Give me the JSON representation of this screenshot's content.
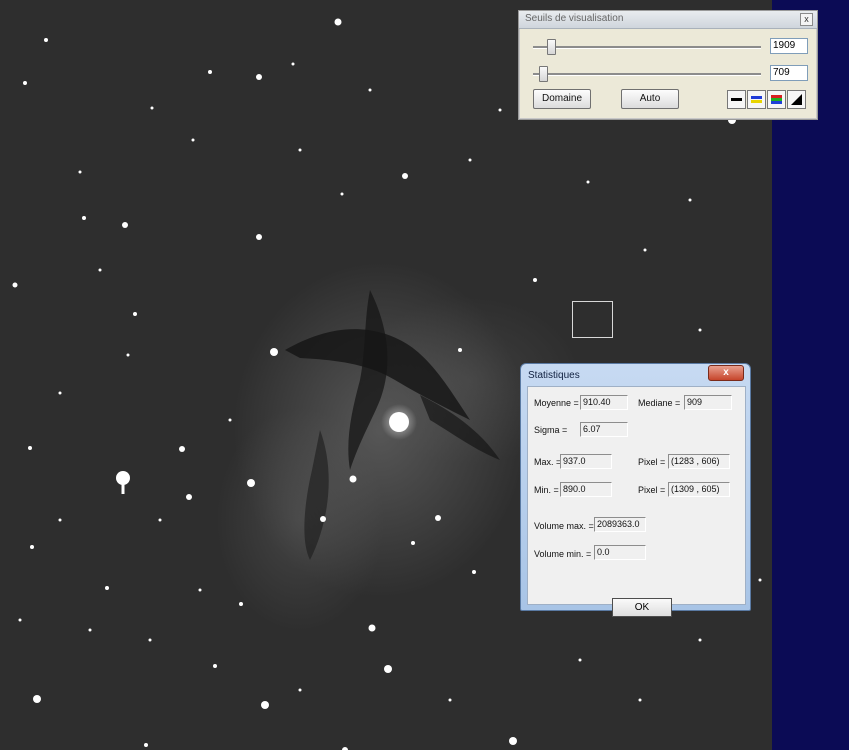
{
  "threshold_panel": {
    "title": "Seuils de visualisation",
    "close_label": "x",
    "high_value": "1909",
    "low_value": "709",
    "domain_button": "Domaine",
    "auto_button": "Auto",
    "palette_buttons": [
      "palette-grey-icon",
      "palette-blue-yellow-icon",
      "palette-rainbow-icon",
      "palette-gradient-icon"
    ]
  },
  "stats_dialog": {
    "title": "Statistiques",
    "close_label": "x",
    "moyenne_label": "Moyenne =",
    "moyenne_value": "910.40",
    "mediane_label": "Mediane =",
    "mediane_value": "909",
    "sigma_label": "Sigma =",
    "sigma_value": "6.07",
    "max_label": "Max. =",
    "max_value": "937.0",
    "max_pixel_label": "Pixel =",
    "max_pixel_value": "(1283 , 606)",
    "min_label": "Min. =",
    "min_value": "890.0",
    "min_pixel_label": "Pixel =",
    "min_pixel_value": "(1309 , 605)",
    "volume_max_label": "Volume max. =",
    "volume_max_value": "2089363.0",
    "volume_min_label": "Volume min. =",
    "volume_min_value": "0.0",
    "ok_label": "OK"
  },
  "colors": {
    "side_strip": "#0b0b55",
    "sky_background": "#2e2e2e"
  }
}
